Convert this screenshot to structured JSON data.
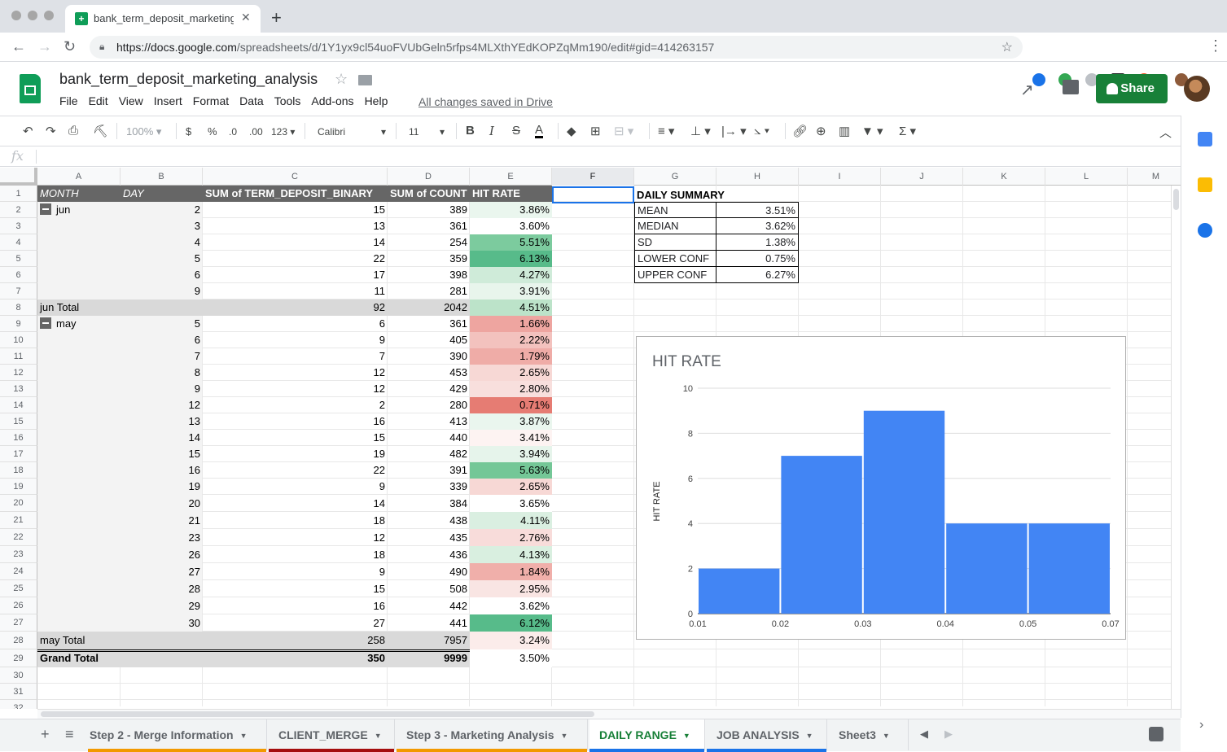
{
  "browser": {
    "tab_title": "bank_term_deposit_marketing_",
    "url_host": "https://docs.google.com",
    "url_path": "/spreadsheets/d/1Y1yx9cl54uoFVUbGeln5rfps4MLXthYEdKOPZqMm190/edit#gid=414263157"
  },
  "doc": {
    "title": "bank_term_deposit_marketing_analysis",
    "menu": [
      "File",
      "Edit",
      "View",
      "Insert",
      "Format",
      "Data",
      "Tools",
      "Add-ons",
      "Help"
    ],
    "saved_status": "All changes saved in Drive",
    "share_label": "Share"
  },
  "toolbar": {
    "zoom": "100%",
    "currency": "$",
    "percent": "%",
    "dec_less": ".0",
    "dec_more": ".00",
    "format_more": "123",
    "font": "Calibri",
    "font_size": "11",
    "bold": "B",
    "italic": "I",
    "strike": "S",
    "text_color": "A",
    "sigma": "Σ"
  },
  "formula_bar": {
    "fx": "fx",
    "value": ""
  },
  "columns": [
    "A",
    "B",
    "C",
    "D",
    "E",
    "F",
    "G",
    "H",
    "I",
    "J",
    "K",
    "L",
    "M"
  ],
  "selected_column": "F",
  "rows": [
    "1",
    "2",
    "3",
    "4",
    "5",
    "6",
    "7",
    "8",
    "9",
    "10",
    "11",
    "12",
    "13",
    "14",
    "15",
    "16",
    "17",
    "18",
    "19",
    "20",
    "21",
    "22",
    "23",
    "24",
    "25",
    "26",
    "27",
    "28",
    "29",
    "30",
    "31",
    "32"
  ],
  "pivot": {
    "headers": [
      "MONTH",
      "DAY",
      "SUM of TERM_DEPOSIT_BINARY",
      "SUM of COUNT",
      "HIT RATE"
    ],
    "rows": [
      {
        "month": "jun",
        "day": "2",
        "sum_td": "15",
        "sum_count": "389",
        "hit_rate": "3.86%",
        "color": "#eaf6ee"
      },
      {
        "month": "",
        "day": "3",
        "sum_td": "13",
        "sum_count": "361",
        "hit_rate": "3.60%",
        "color": "#ffffff"
      },
      {
        "month": "",
        "day": "4",
        "sum_td": "14",
        "sum_count": "254",
        "hit_rate": "5.51%",
        "color": "#7ccb9e"
      },
      {
        "month": "",
        "day": "5",
        "sum_td": "22",
        "sum_count": "359",
        "hit_rate": "6.13%",
        "color": "#57bb8a"
      },
      {
        "month": "",
        "day": "6",
        "sum_td": "17",
        "sum_count": "398",
        "hit_rate": "4.27%",
        "color": "#cfebd9"
      },
      {
        "month": "",
        "day": "9",
        "sum_td": "11",
        "sum_count": "281",
        "hit_rate": "3.91%",
        "color": "#e8f5ec"
      },
      {
        "total": "jun Total",
        "sum_td": "92",
        "sum_count": "2042",
        "hit_rate": "4.51%",
        "color": "#bce3c9"
      },
      {
        "month": "may",
        "day": "5",
        "sum_td": "6",
        "sum_count": "361",
        "hit_rate": "1.66%",
        "color": "#eea5a0"
      },
      {
        "month": "",
        "day": "6",
        "sum_td": "9",
        "sum_count": "405",
        "hit_rate": "2.22%",
        "color": "#f3c2be"
      },
      {
        "month": "",
        "day": "7",
        "sum_td": "7",
        "sum_count": "390",
        "hit_rate": "1.79%",
        "color": "#efaca7"
      },
      {
        "month": "",
        "day": "8",
        "sum_td": "12",
        "sum_count": "453",
        "hit_rate": "2.65%",
        "color": "#f7d8d5"
      },
      {
        "month": "",
        "day": "9",
        "sum_td": "12",
        "sum_count": "429",
        "hit_rate": "2.80%",
        "color": "#f8dfdd"
      },
      {
        "month": "",
        "day": "12",
        "sum_td": "2",
        "sum_count": "280",
        "hit_rate": "0.71%",
        "color": "#e67c73"
      },
      {
        "month": "",
        "day": "13",
        "sum_td": "16",
        "sum_count": "413",
        "hit_rate": "3.87%",
        "color": "#eaf6ee"
      },
      {
        "month": "",
        "day": "14",
        "sum_td": "15",
        "sum_count": "440",
        "hit_rate": "3.41%",
        "color": "#fdf3f2"
      },
      {
        "month": "",
        "day": "15",
        "sum_td": "19",
        "sum_count": "482",
        "hit_rate": "3.94%",
        "color": "#e6f4eb"
      },
      {
        "month": "",
        "day": "16",
        "sum_td": "22",
        "sum_count": "391",
        "hit_rate": "5.63%",
        "color": "#74c797"
      },
      {
        "month": "",
        "day": "19",
        "sum_td": "9",
        "sum_count": "339",
        "hit_rate": "2.65%",
        "color": "#f7d8d5"
      },
      {
        "month": "",
        "day": "20",
        "sum_td": "14",
        "sum_count": "384",
        "hit_rate": "3.65%",
        "color": "#ffffff"
      },
      {
        "month": "",
        "day": "21",
        "sum_td": "18",
        "sum_count": "438",
        "hit_rate": "4.11%",
        "color": "#daefe1"
      },
      {
        "month": "",
        "day": "23",
        "sum_td": "12",
        "sum_count": "435",
        "hit_rate": "2.76%",
        "color": "#f8dcda"
      },
      {
        "month": "",
        "day": "26",
        "sum_td": "18",
        "sum_count": "436",
        "hit_rate": "4.13%",
        "color": "#d9efe0"
      },
      {
        "month": "",
        "day": "27",
        "sum_td": "9",
        "sum_count": "490",
        "hit_rate": "1.84%",
        "color": "#f0afaa"
      },
      {
        "month": "",
        "day": "28",
        "sum_td": "15",
        "sum_count": "508",
        "hit_rate": "2.95%",
        "color": "#f9e5e3"
      },
      {
        "month": "",
        "day": "29",
        "sum_td": "16",
        "sum_count": "442",
        "hit_rate": "3.62%",
        "color": "#ffffff"
      },
      {
        "month": "",
        "day": "30",
        "sum_td": "27",
        "sum_count": "441",
        "hit_rate": "6.12%",
        "color": "#57bb8a"
      },
      {
        "total": "may Total",
        "sum_td": "258",
        "sum_count": "7957",
        "hit_rate": "3.24%",
        "color": "#fbecea"
      },
      {
        "total": "Grand Total",
        "sum_td": "350",
        "sum_count": "9999",
        "hit_rate": "3.50%",
        "color": "#ffffff",
        "grand": true
      }
    ]
  },
  "summary": {
    "title": "DAILY SUMMARY",
    "rows": [
      {
        "label": "MEAN",
        "value": "3.51%"
      },
      {
        "label": "MEDIAN",
        "value": "3.62%"
      },
      {
        "label": "SD",
        "value": "1.38%"
      },
      {
        "label": "LOWER CONF",
        "value": "0.75%"
      },
      {
        "label": "UPPER CONF",
        "value": "6.27%"
      }
    ]
  },
  "chart_data": {
    "type": "bar",
    "title": "HIT RATE",
    "ylabel": "HIT RATE",
    "xlabel": "",
    "bins": [
      [
        0.01,
        0.02
      ],
      [
        0.02,
        0.03
      ],
      [
        0.03,
        0.04
      ],
      [
        0.04,
        0.05
      ],
      [
        0.05,
        0.07
      ]
    ],
    "values": [
      2,
      7,
      9,
      4,
      4
    ],
    "x_ticks": [
      "0.01",
      "0.02",
      "0.03",
      "0.04",
      "0.05",
      "0.07"
    ],
    "y_ticks": [
      "0",
      "2",
      "4",
      "6",
      "8",
      "10"
    ],
    "ylim": [
      0,
      10
    ],
    "color": "#4285f4",
    "grid": true
  },
  "sheets": [
    {
      "name": "Step 2 - Merge Information",
      "color": "#f29900"
    },
    {
      "name": "CLIENT_MERGE",
      "color": "#a50e0e"
    },
    {
      "name": "Step 3 - Marketing Analysis",
      "color": "#f29900"
    },
    {
      "name": "DAILY RANGE",
      "color": "#1a73e8",
      "active": true
    },
    {
      "name": "JOB ANALYSIS",
      "color": "#1a73e8"
    },
    {
      "name": "Sheet3",
      "color": ""
    }
  ]
}
